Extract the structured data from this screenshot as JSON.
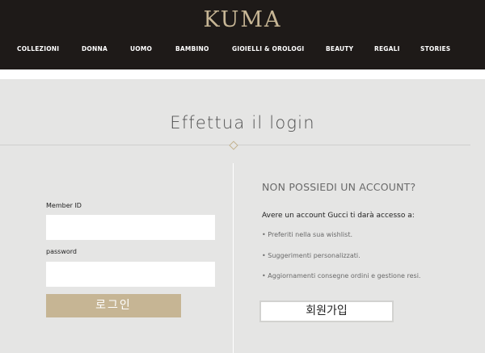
{
  "header": {
    "logo": "KUMA",
    "nav": [
      "COLLEZIONI",
      "DONNA",
      "UOMO",
      "BAMBINO",
      "GIOIELLI & OROLOGI",
      "BEAUTY",
      "REGALI",
      "STORIES"
    ]
  },
  "page": {
    "title": "Effettua il login"
  },
  "login": {
    "member_id_label": "Member ID",
    "member_id_value": "",
    "password_label": "password",
    "password_value": "",
    "submit_label": "로그인"
  },
  "register": {
    "title": "NON POSSIEDI UN ACCOUNT?",
    "intro": "Avere un account Gucci ti darà accesso a:",
    "benefits": [
      "Preferiti nella sua wishlist.",
      "Suggerimenti personalizzati.",
      "Aggiornamenti consegne ordini e gestione resi."
    ],
    "signup_label": "회원가입"
  },
  "colors": {
    "header_bg": "#1e1a18",
    "accent_gold": "#c6b594",
    "panel_bg": "#e5e5e4"
  }
}
